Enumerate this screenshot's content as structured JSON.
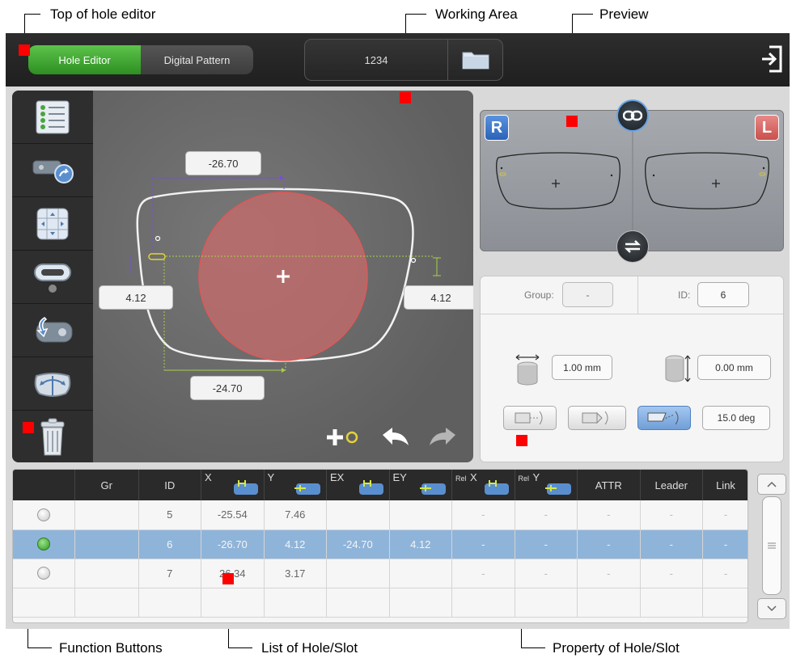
{
  "callouts": {
    "top_of_hole_editor": "Top of hole editor",
    "working_area": "Working Area",
    "preview": "Preview",
    "function_buttons": "Function Buttons",
    "list_of_hole_slot": "List of Hole/Slot",
    "property_of_hole_slot": "Property of Hole/Slot"
  },
  "topbar": {
    "tab_hole_editor": "Hole Editor",
    "tab_digital_pattern": "Digital Pattern",
    "job_number": "1234",
    "icons": [
      "folder-icon",
      "logout-icon"
    ]
  },
  "function_buttons": {
    "icons": [
      "hole-list-icon",
      "copy-hole-icon",
      "move-position-icon",
      "slot-icon",
      "mirror-hole-icon",
      "rotate-lens-icon",
      "trash-icon"
    ]
  },
  "working_area": {
    "top_dimension": "-26.70",
    "left_dimension": "4.12",
    "right_dimension": "4.12",
    "bottom_dimension": "-24.70",
    "tools": [
      "add-hole-icon",
      "undo-icon",
      "redo-icon"
    ]
  },
  "preview": {
    "right_label": "R",
    "left_label": "L",
    "icons": [
      "link-icon",
      "swap-icon"
    ]
  },
  "properties": {
    "group_label": "Group:",
    "group_value": "-",
    "id_label": "ID:",
    "id_value": "6",
    "diameter": "1.00 mm",
    "depth": "0.00 mm",
    "angle": "15.0 deg",
    "hole_types": [
      {
        "icon": "straight-hole-icon",
        "active": false
      },
      {
        "icon": "countersink-hole-icon",
        "active": false
      },
      {
        "icon": "angled-hole-icon",
        "active": true
      }
    ]
  },
  "table": {
    "headers": [
      "",
      "Gr",
      "ID",
      "X",
      "Y",
      "EX",
      "EY",
      "X",
      "Y",
      "ATTR",
      "Leader",
      "Link"
    ],
    "rel_prefix": "Rel",
    "rows": [
      {
        "selected": false,
        "cells": [
          "",
          "5",
          "-25.54",
          "7.46",
          "",
          "",
          "-",
          "-",
          "-",
          "-",
          "-"
        ]
      },
      {
        "selected": true,
        "cells": [
          "",
          "6",
          "-26.70",
          "4.12",
          "-24.70",
          "4.12",
          "-",
          "-",
          "-",
          "-",
          "-"
        ]
      },
      {
        "selected": false,
        "cells": [
          "",
          "7",
          "26.34",
          "3.17",
          "",
          "",
          "-",
          "-",
          "-",
          "-",
          "-"
        ]
      }
    ]
  },
  "colors": {
    "accent_green": "#3aa52c",
    "selected_row": "#8fb4d9",
    "lens_fill": "#c46a6a",
    "marker_red": "#ff0000",
    "dim_purple": "#7a4fd6",
    "dim_green": "#a7d14a"
  }
}
